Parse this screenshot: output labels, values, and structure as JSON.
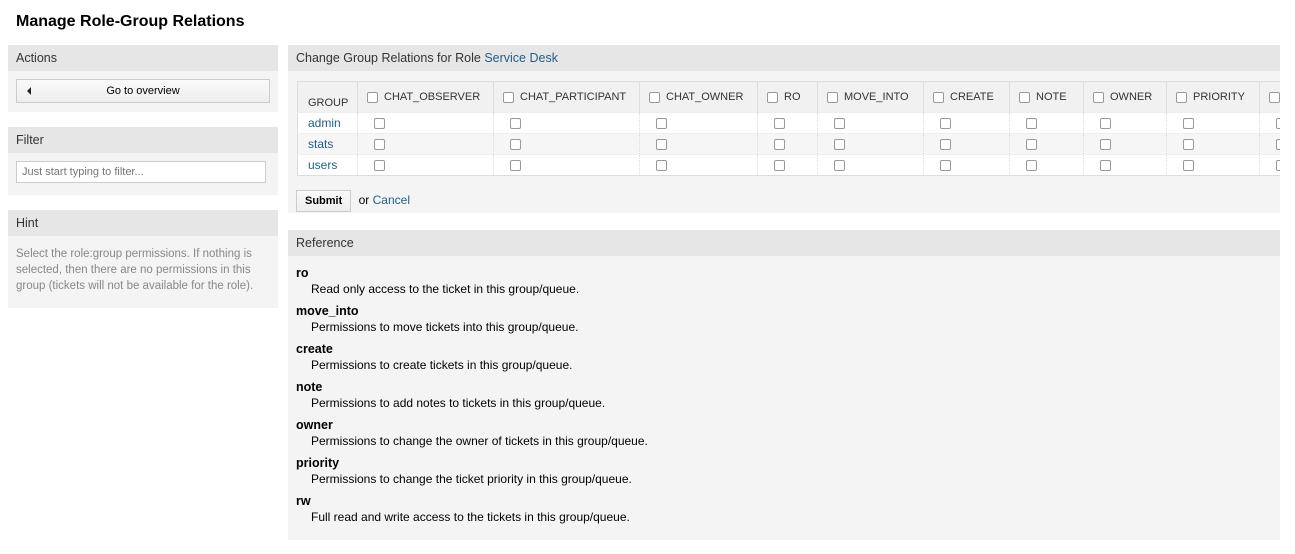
{
  "page_title": "Manage Role-Group Relations",
  "sidebar": {
    "actions": {
      "title": "Actions",
      "go_overview": "Go to overview"
    },
    "filter": {
      "title": "Filter",
      "placeholder": "Just start typing to filter..."
    },
    "hint": {
      "title": "Hint",
      "text": "Select the role:group permissions. If nothing is selected, then there are no permissions in this group (tickets will not be available for the role)."
    }
  },
  "main": {
    "title_prefix": "Change Group Relations for Role ",
    "role": "Service Desk",
    "group_header": "GROUP",
    "columns": [
      "CHAT_OBSERVER",
      "CHAT_PARTICIPANT",
      "CHAT_OWNER",
      "RO",
      "MOVE_INTO",
      "CREATE",
      "NOTE",
      "OWNER",
      "PRIORITY",
      ""
    ],
    "groups": [
      "admin",
      "stats",
      "users"
    ],
    "submit": "Submit",
    "or": "or",
    "cancel": "Cancel"
  },
  "reference": {
    "title": "Reference",
    "items": [
      {
        "term": "ro",
        "desc": "Read only access to the ticket in this group/queue."
      },
      {
        "term": "move_into",
        "desc": "Permissions to move tickets into this group/queue."
      },
      {
        "term": "create",
        "desc": "Permissions to create tickets in this group/queue."
      },
      {
        "term": "note",
        "desc": "Permissions to add notes to tickets in this group/queue."
      },
      {
        "term": "owner",
        "desc": "Permissions to change the owner of tickets in this group/queue."
      },
      {
        "term": "priority",
        "desc": "Permissions to change the ticket priority in this group/queue."
      },
      {
        "term": "rw",
        "desc": "Full read and write access to the tickets in this group/queue."
      }
    ]
  }
}
